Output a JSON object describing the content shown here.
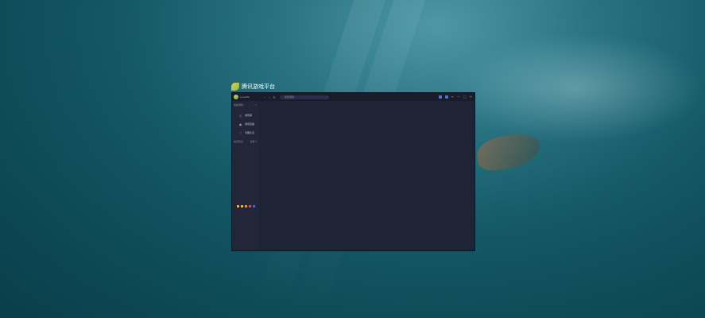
{
  "app": {
    "title": "腾讯游戏平台"
  },
  "topbar": {
    "user_name": "Lovelife",
    "back_symbol": "‹",
    "forward_symbol": "›",
    "refresh_symbol": "↻",
    "search_placeholder": "搜索游戏",
    "window_controls": [
      "≡",
      "—",
      "□",
      "✕"
    ]
  },
  "sidebar": {
    "section_label": "我的游戏",
    "section_toggle": "+",
    "items": [
      {
        "label": "游戏库",
        "icon": "diamond-icon"
      },
      {
        "label": "游戏直播",
        "icon": "live-icon"
      },
      {
        "label": "专属礼包",
        "icon": "gift-icon"
      }
    ],
    "recent_label": "最近玩过",
    "recent_sort": "全部 ▾",
    "footer_dot_colors": [
      "#f2c94c",
      "#f2c94c",
      "#e8a33d",
      "#d85a4a",
      "#4f6ad8"
    ]
  },
  "colors": {
    "accent": "#3f7bd9",
    "window_bg": "#1f2336",
    "sidebar_bg": "#232639"
  }
}
